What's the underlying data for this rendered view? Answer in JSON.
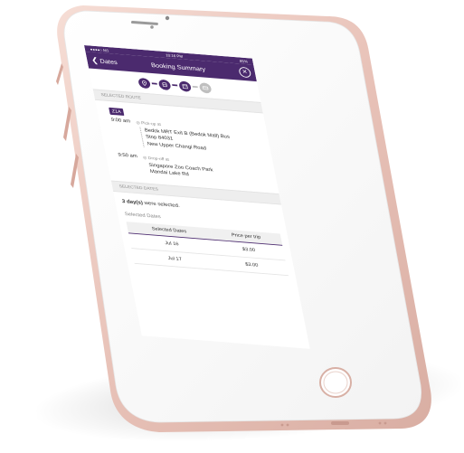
{
  "status": {
    "carrier": "●●●●○ M1",
    "time": "10:16 PM",
    "battery": "85%"
  },
  "nav": {
    "back_label": "Dates",
    "title": "Booking Summary",
    "close_symbol": "✕"
  },
  "steps": [
    {
      "icon": "map-pin-icon",
      "active": true
    },
    {
      "icon": "bus-icon",
      "active": true
    },
    {
      "icon": "calendar-icon",
      "active": true
    },
    {
      "icon": "card-icon",
      "active": false
    }
  ],
  "route": {
    "section_label": "SELECTED ROUTE",
    "code": "Z1A",
    "pickup": {
      "time": "9:00 am",
      "kind": "Pick-up at",
      "lines": [
        "Bedok MRT Exit B (Bedok Mall) Bus",
        "Stop 84031",
        "New Upper Changi Road"
      ]
    },
    "dropoff": {
      "time": "9:50 am",
      "kind": "Drop-off at",
      "lines": [
        "Singapore Zoo Coach Park",
        "Mandai Lake Rd"
      ]
    }
  },
  "dates": {
    "section_label": "SELECTED DATES",
    "message_bold": "3 day(s)",
    "message_rest": " were selected.",
    "subheading": "Selected Dates",
    "columns": [
      "Selected Dates",
      "Price per trip"
    ],
    "rows": [
      [
        "Jul 16",
        "$3.00"
      ],
      [
        "Jul 17",
        "$3.00"
      ]
    ]
  },
  "colors": {
    "brand": "#4b2a6e",
    "body_rose_gold": "#efcfc6",
    "bezel": "#ffffff"
  }
}
